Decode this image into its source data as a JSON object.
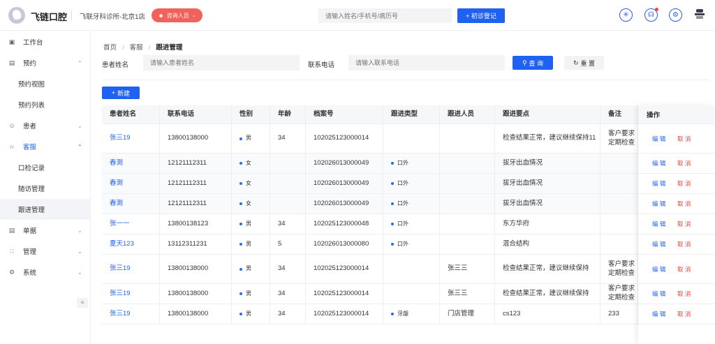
{
  "header": {
    "app_name": "飞链口腔",
    "clinic": "飞联牙科诊所-北京1店",
    "staff_button": "咨询人员",
    "search_placeholder": "请输入姓名/手机号/病历号",
    "register_button": "+ 初诊登记",
    "icons": [
      "sun-icon",
      "bell-icon",
      "settings-icon",
      "avatar-icon"
    ]
  },
  "sidebar": {
    "items": [
      {
        "label": "工作台",
        "icon": "dashboard-icon"
      },
      {
        "label": "预约",
        "icon": "calendar-icon"
      },
      {
        "label": "预约视图"
      },
      {
        "label": "预约列表"
      },
      {
        "label": "患者",
        "icon": "patient-icon"
      },
      {
        "label": "客服",
        "icon": "headset-icon"
      },
      {
        "label": "口检记录"
      },
      {
        "label": "随访管理"
      },
      {
        "label": "跟进管理"
      },
      {
        "label": "单据",
        "icon": "document-icon"
      },
      {
        "label": "管理",
        "icon": "grid-icon"
      },
      {
        "label": "系统",
        "icon": "gear-icon"
      }
    ]
  },
  "breadcrumb": {
    "items": [
      "首页",
      "客服",
      "跟进管理"
    ]
  },
  "filters": {
    "name_label": "患者姓名",
    "name_placeholder": "请输入患者姓名",
    "phone_label": "联系电话",
    "phone_placeholder": "请输入联系电话",
    "query_button": "查 询",
    "reset_button": "重 置"
  },
  "new_button": "新建",
  "table": {
    "columns": [
      "患者姓名",
      "联系电话",
      "性别",
      "年龄",
      "档案号",
      "跟进类型",
      "跟进人员",
      "跟进要点",
      "备注",
      "操作"
    ],
    "edit_label": "编 辑",
    "cancel_label": "取 消",
    "rows": [
      {
        "name": "张三19",
        "phone": "13800138000",
        "gender": "男",
        "age": "34",
        "file": "102025123000014",
        "type": "",
        "staff": "",
        "point": "检查结果正常，建议继续保持11",
        "note": "客户要求定期检查"
      },
      {
        "name": "春測",
        "phone": "12121112311",
        "gender": "女",
        "age": "",
        "file": "102026013000049",
        "type": "口外",
        "staff": "",
        "point": "拔牙出血情况",
        "note": ""
      },
      {
        "name": "春測",
        "phone": "12121112311",
        "gender": "女",
        "age": "",
        "file": "102026013000049",
        "type": "口外",
        "staff": "",
        "point": "拔牙出血情况",
        "note": ""
      },
      {
        "name": "春測",
        "phone": "12121112311",
        "gender": "女",
        "age": "",
        "file": "102026013000049",
        "type": "口外",
        "staff": "",
        "point": "拔牙出血情况",
        "note": ""
      },
      {
        "name": "张一一",
        "phone": "13800138123",
        "gender": "男",
        "age": "34",
        "file": "102025123000048",
        "type": "口外",
        "staff": "",
        "point": "东方华府",
        "note": ""
      },
      {
        "name": "夏天123",
        "phone": "13112311231",
        "gender": "男",
        "age": "5",
        "file": "102026013000080",
        "type": "口外",
        "staff": "",
        "point": "混合结构",
        "note": ""
      },
      {
        "name": "张三19",
        "phone": "13800138000",
        "gender": "男",
        "age": "34",
        "file": "102025123000014",
        "type": "",
        "staff": "张三三",
        "point": "检查结果正常，建议继续保持",
        "note": "客户要求定期检查"
      },
      {
        "name": "张三19",
        "phone": "13800138000",
        "gender": "男",
        "age": "34",
        "file": "102025123000014",
        "type": "",
        "staff": "张三三",
        "point": "检查结果正常，建议继续保持",
        "note": "客户要求定期检查"
      },
      {
        "name": "张三19",
        "phone": "13800138000",
        "gender": "男",
        "age": "34",
        "file": "102025123000014",
        "type": "牙龈",
        "staff": "门店管理",
        "point": "cs123",
        "note": "233"
      }
    ]
  }
}
